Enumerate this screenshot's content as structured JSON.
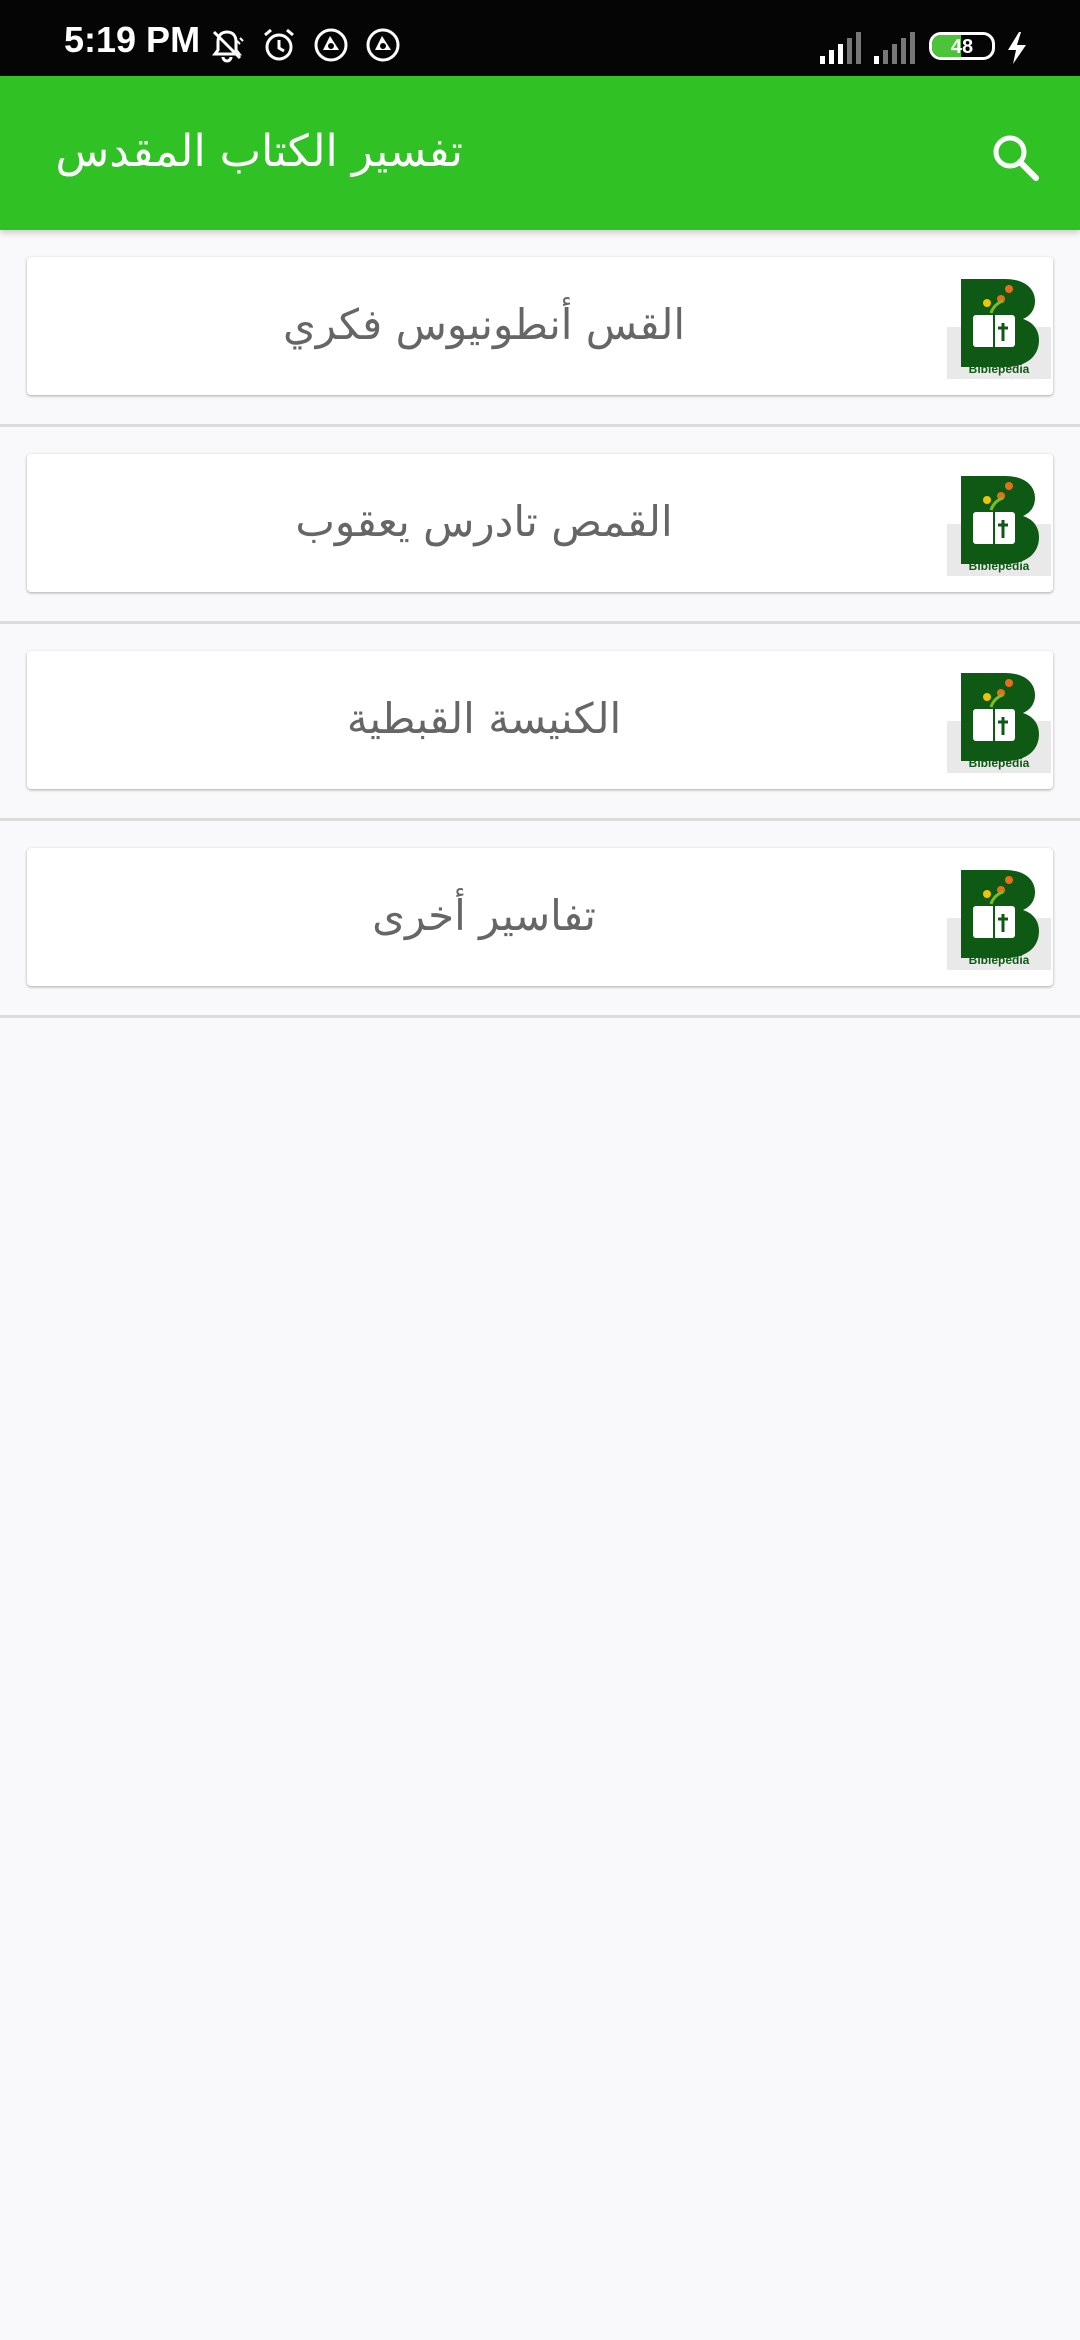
{
  "status_bar": {
    "time": "5:19 PM",
    "battery_level": "48",
    "battery_percent": 48,
    "icons_left": [
      "mute-vibrate-icon",
      "alarm-icon",
      "sync-icon",
      "sync-icon"
    ],
    "icons_right": [
      "signal-icon",
      "signal-icon",
      "battery-icon",
      "charging-icon"
    ]
  },
  "app_bar": {
    "title": "تفسير الكتاب المقدس",
    "search_icon": "search-icon",
    "color": "#30c125"
  },
  "list": {
    "items": [
      {
        "label": "القس أنطونيوس فكري",
        "logo_text": "Biblepedia"
      },
      {
        "label": "القمص تادرس يعقوب",
        "logo_text": "Biblepedia"
      },
      {
        "label": "الكنيسة القبطية",
        "logo_text": "Biblepedia"
      },
      {
        "label": "تفاسير أخرى",
        "logo_text": "Biblepedia"
      }
    ]
  },
  "colors": {
    "accent": "#30c125",
    "logo_green": "#0e5a14",
    "background": "#f9f8fb",
    "text": "#666666"
  }
}
